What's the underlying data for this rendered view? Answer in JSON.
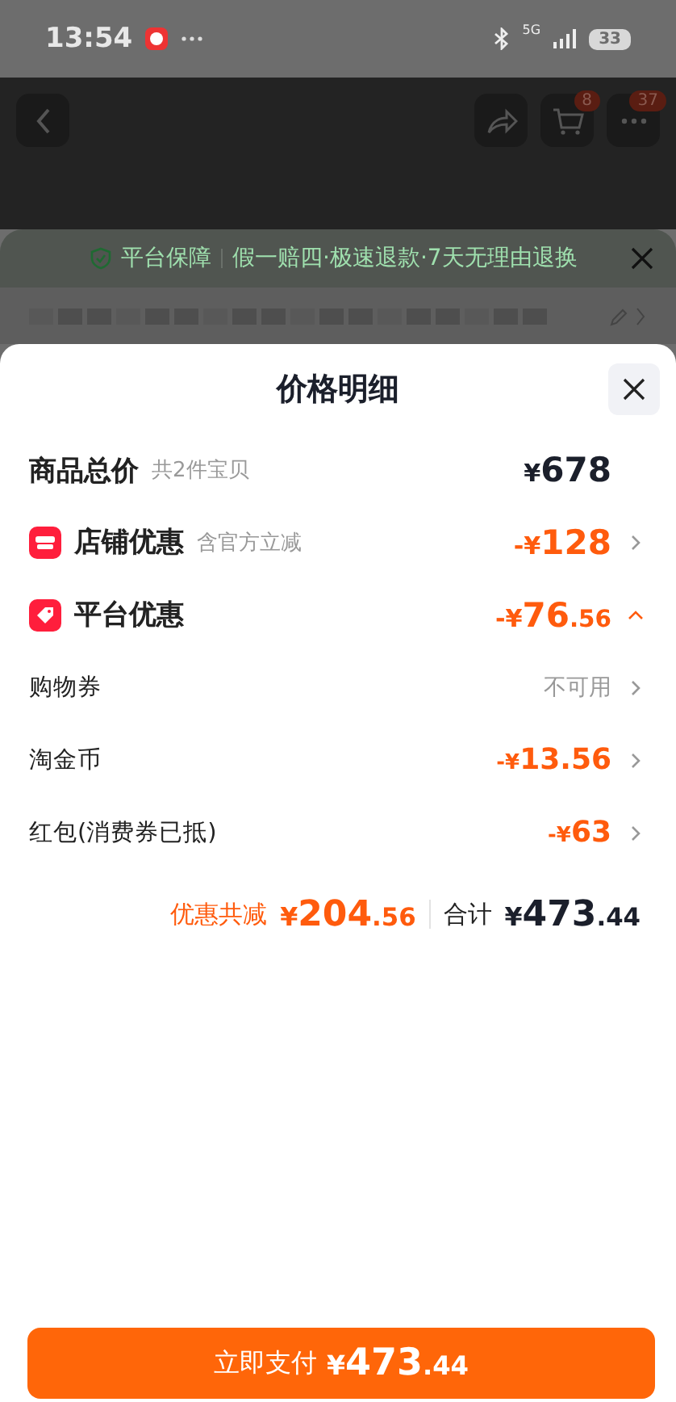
{
  "status_bar": {
    "time": "13:54",
    "network": "5G",
    "battery": "33"
  },
  "header": {
    "badges": [
      {
        "kind": "cart",
        "count": "8"
      },
      {
        "kind": "more",
        "count": "37"
      }
    ]
  },
  "guarantee_banner": {
    "title": "平台保障",
    "text": "假一赔四·极速退款·7天无理由退换"
  },
  "sheet": {
    "title": "价格明细",
    "total_row": {
      "label": "商品总价",
      "note": "共2件宝贝",
      "price": {
        "prefix": "¥",
        "whole": "678"
      }
    },
    "discounts": [
      {
        "kind": "store",
        "label": "店铺优惠",
        "note": "含官方立减",
        "price": {
          "prefix": "-¥",
          "whole": "128"
        },
        "expanded": false
      },
      {
        "kind": "platform",
        "label": "平台优惠",
        "price": {
          "prefix": "-¥",
          "whole": "76",
          "fraction": ".56"
        },
        "expanded": true
      }
    ],
    "sub_items": [
      {
        "label": "购物券",
        "value": "不可用",
        "kind": "text"
      },
      {
        "label": "淘金币",
        "price": {
          "prefix": "-¥",
          "whole": "13.56"
        },
        "kind": "price"
      },
      {
        "label": "红包(消费券已抵)",
        "price": {
          "prefix": "-¥",
          "whole": "63"
        },
        "kind": "price"
      }
    ],
    "summary": {
      "saved_label": "优惠共减",
      "saved": {
        "prefix": "¥",
        "whole": "204",
        "fraction": ".56"
      },
      "total_label": "合计",
      "total": {
        "prefix": "¥",
        "whole": "473",
        "fraction": ".44"
      }
    },
    "pay_button": {
      "label": "立即支付",
      "price": {
        "prefix": "¥",
        "whole": "473",
        "fraction": ".44"
      }
    }
  }
}
